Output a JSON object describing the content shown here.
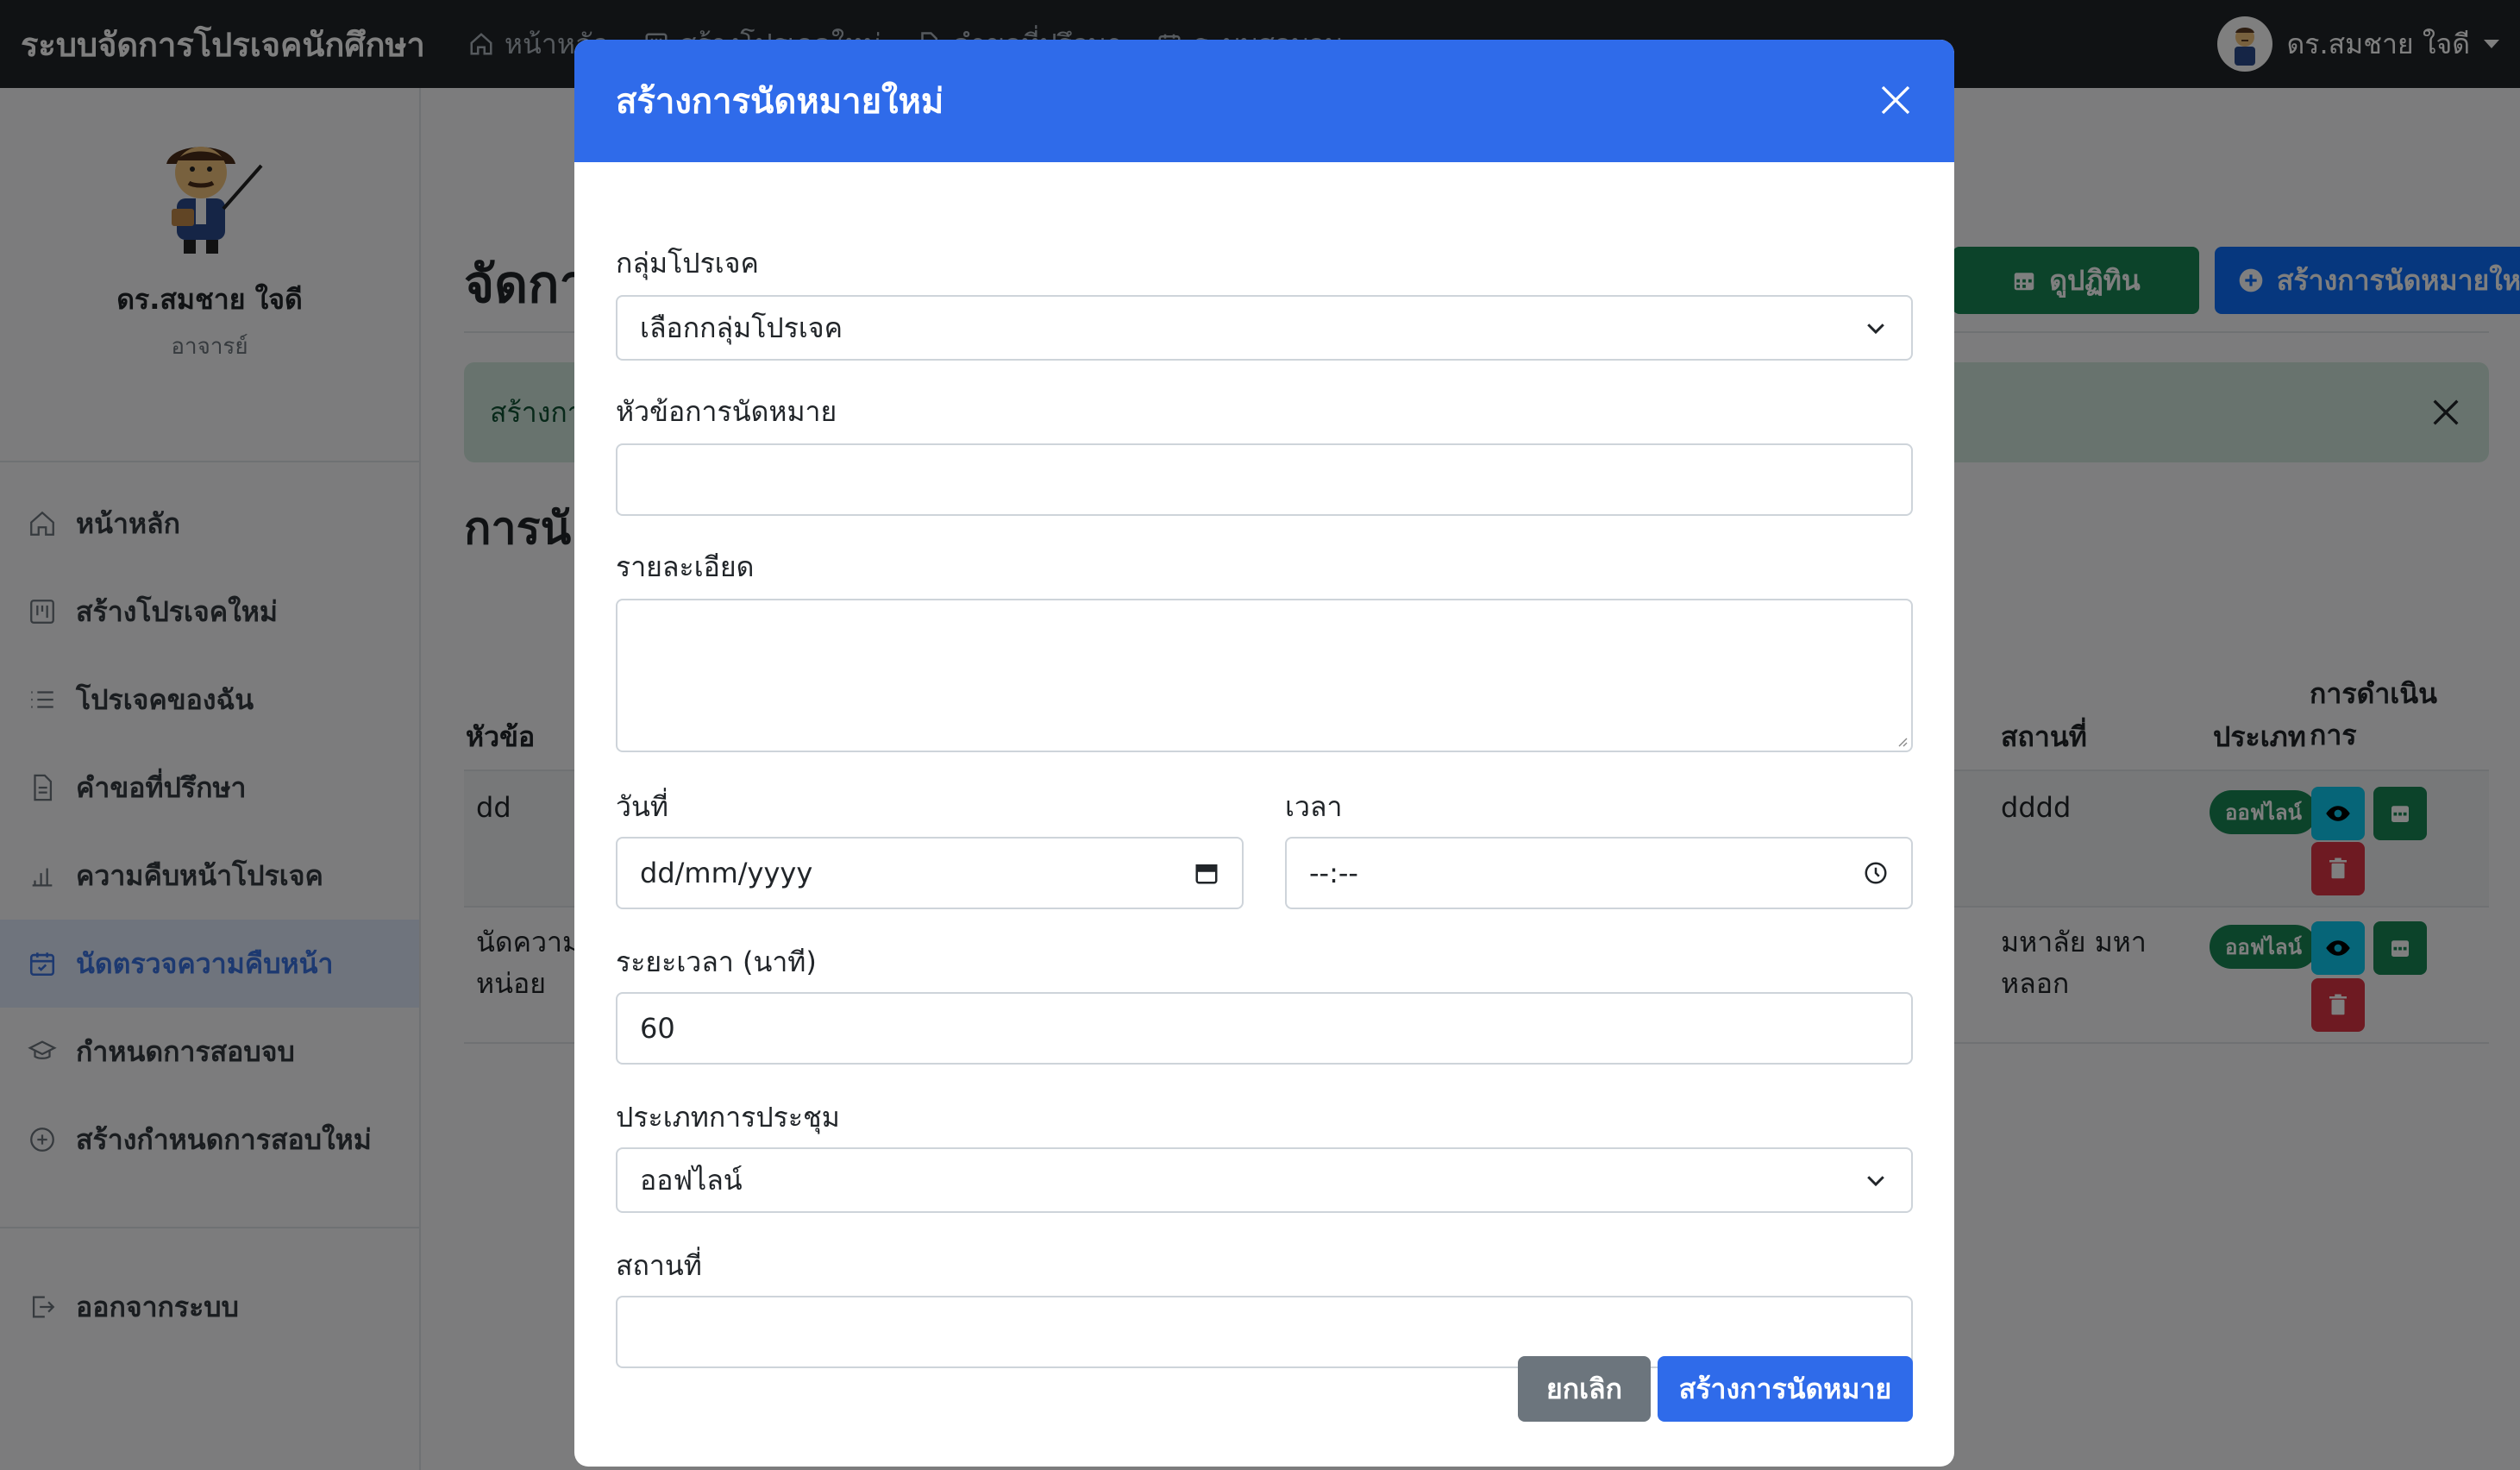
{
  "navbar": {
    "brand": "ระบบจัดการโปรเจคนักศึกษา",
    "links": [
      {
        "label": "หน้าหลัก",
        "icon": "home-icon"
      },
      {
        "label": "สร้างโปรเจคใหม่",
        "icon": "kanban-icon"
      },
      {
        "label": "คำขอที่ปรึกษา",
        "icon": "file-icon"
      },
      {
        "label": "ระบบสอบจบ",
        "icon": "calendar-icon"
      }
    ],
    "user": "ดร.สมชาย ใจดี"
  },
  "sidebar": {
    "name": "ดร.สมชาย ใจดี",
    "role": "อาจารย์",
    "items": [
      {
        "label": "หน้าหลัก",
        "icon": "home-icon"
      },
      {
        "label": "สร้างโปรเจคใหม่",
        "icon": "kanban-icon"
      },
      {
        "label": "โปรเจคของฉัน",
        "icon": "list-icon"
      },
      {
        "label": "คำขอที่ปรึกษา",
        "icon": "file-icon"
      },
      {
        "label": "ความคืบหน้าโปรเจค",
        "icon": "bar-chart-icon"
      },
      {
        "label": "นัดตรวจความคืบหน้า",
        "icon": "calendar-check-icon"
      },
      {
        "label": "กำหนดการสอบจบ",
        "icon": "mortarboard-icon"
      },
      {
        "label": "สร้างกำหนดการสอบใหม่",
        "icon": "plus-circle-icon"
      }
    ],
    "logout": "ออกจากระบบ"
  },
  "main": {
    "title": "จัดกา",
    "calendar_button": "ดูปฏิทิน",
    "new_button": "สร้างการนัดหมายใหม่",
    "alert": "สร้างกา",
    "section_title": "การนั",
    "table": {
      "headers": {
        "topic": "หัวข้อ",
        "location": "สถานที่",
        "type": "ประเภท",
        "actions_1": "การดำเนิน",
        "actions_2": "การ"
      },
      "rows": [
        {
          "topic_1": "dd",
          "topic_2": "",
          "location_1": "dddd",
          "location_2": "",
          "type": "ออฟไลน์"
        },
        {
          "topic_1": "นัดความ",
          "topic_2": "หน่อย",
          "location_1": "มหาลัย มหา",
          "location_2": "หลอก",
          "type": "ออฟไลน์"
        }
      ]
    }
  },
  "modal": {
    "title": "สร้างการนัดหมายใหม่",
    "group_label": "กลุ่มโปรเจค",
    "group_value": "เลือกกลุ่มโปรเจค",
    "topic_label": "หัวข้อการนัดหมาย",
    "topic_value": "",
    "detail_label": "รายละเอียด",
    "date_label": "วันที่",
    "date_placeholder": "dd/mm/yyyy",
    "time_label": "เวลา",
    "time_placeholder": "--:--",
    "duration_label": "ระยะเวลา (นาที)",
    "duration_value": "60",
    "meeting_type_label": "ประเภทการประชุม",
    "meeting_type_value": "ออฟไลน์",
    "location_label": "สถานที่",
    "location_value": "",
    "cancel_button": "ยกเลิก",
    "submit_button": "สร้างการนัดหมาย"
  },
  "colors": {
    "primary": "#2f6bea",
    "success": "#198754",
    "danger": "#dc3545",
    "info": "#0dcaf0",
    "secondary": "#6c757d",
    "navbar": "#212529"
  }
}
